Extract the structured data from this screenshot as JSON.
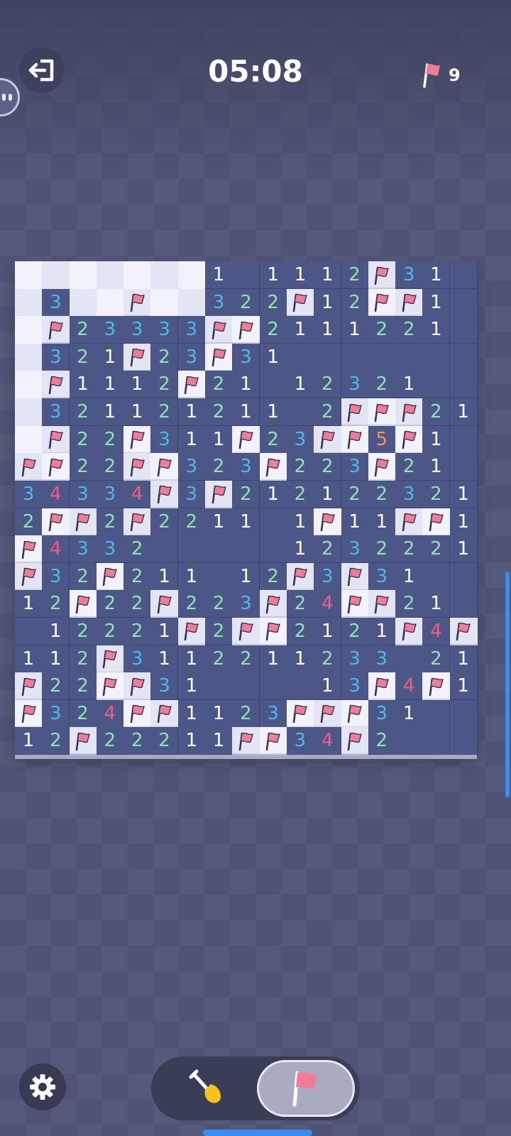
{
  "header": {
    "exit_icon": "exit-icon",
    "timer": "05:08",
    "flags_remaining": "9",
    "flag_icon": "flag-icon"
  },
  "colors": {
    "1": "#ffffff",
    "2": "#8fe3b2",
    "3": "#4ab9ec",
    "4": "#ef5d83",
    "5": "#ef9a55",
    "flag": "#ef7d98",
    "covered_light": "#f1f2fb",
    "covered_dark": "#e3e5f5",
    "open": "#4c5687"
  },
  "board": {
    "rows": 18,
    "cols": 17,
    "legend": "? = covered, F = flagged, . = open empty, digit = number",
    "grid": [
      "???????1.1112F31.",
      "?3??F??322F12FF1.",
      "?F23333FF2111221.",
      "?321F23F31.......",
      "?F1112F21.12321..",
      "?321121211.2FFF21.",
      "?F22F311F23FF5F1.",
      "FF22FF323F223F21.",
      "34334F3F212122321",
      "2FF2F2211.1F11FF1",
      "F4332.....1232221",
      "F32F211.12F3F31..",
      "12F22F223F24FF21.",
      ".12221F2FF2121F4F1",
      "112F3112211233 21.",
      "F22FF31....13F4F1..",
      "F324FF1123FFF31..",
      "12F22211FF34F2..."
    ]
  },
  "controls": {
    "settings_icon": "gear-icon",
    "dig_icon": "shovel-icon",
    "flag_mode_icon": "flag-icon",
    "active_mode": "flag"
  }
}
